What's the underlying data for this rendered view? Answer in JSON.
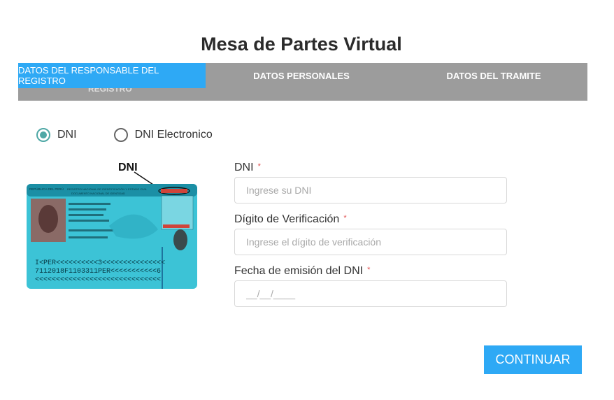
{
  "page": {
    "title": "Mesa de Partes Virtual"
  },
  "tabs": [
    {
      "label": "DATOS DEL RESPONSABLE DEL REGISTRO",
      "active": true
    },
    {
      "label": "DATOS PERSONALES",
      "active": false
    },
    {
      "label": "DATOS DEL TRAMITE",
      "active": false
    }
  ],
  "tab_overflow_text": "REGISTRO",
  "doc_type": {
    "options": [
      {
        "label": "DNI",
        "checked": true
      },
      {
        "label": "DNI Electronico",
        "checked": false
      }
    ]
  },
  "id_card": {
    "callout_label": "DNI",
    "country_text": "REPÚBLICA DEL PERÚ",
    "registry_text": "REGISTRO NACIONAL DE IDENTIFICACIÓN Y ESTADO CIVIL",
    "document_text": "DOCUMENTO NACIONAL DE IDENTIDAD",
    "mrz_lines": [
      "I<PER<<<<<<<<<<3<<<<<<<<<<<<<<<",
      "7112018F1103311PER<<<<<<<<<<<6",
      "<<<<<<<<<<<<<<<<<<<<<<<<<<<<<<"
    ]
  },
  "form": {
    "dni": {
      "label": "DNI",
      "required_mark": "*",
      "placeholder": "Ingrese su DNI",
      "value": ""
    },
    "verification_digit": {
      "label": "Dígito de Verificación",
      "required_mark": "*",
      "placeholder": "Ingrese el dígito de verificación",
      "value": ""
    },
    "issue_date": {
      "label": "Fecha de emisión del DNI",
      "required_mark": "*",
      "placeholder": "__/__/____",
      "value": ""
    }
  },
  "actions": {
    "continue_label": "CONTINUAR"
  },
  "colors": {
    "accent": "#2ea9f5",
    "tab_bar": "#9c9c9c",
    "radio_checked": "#4fa8a6",
    "required": "#e05050",
    "card": "#3cc3d6"
  }
}
